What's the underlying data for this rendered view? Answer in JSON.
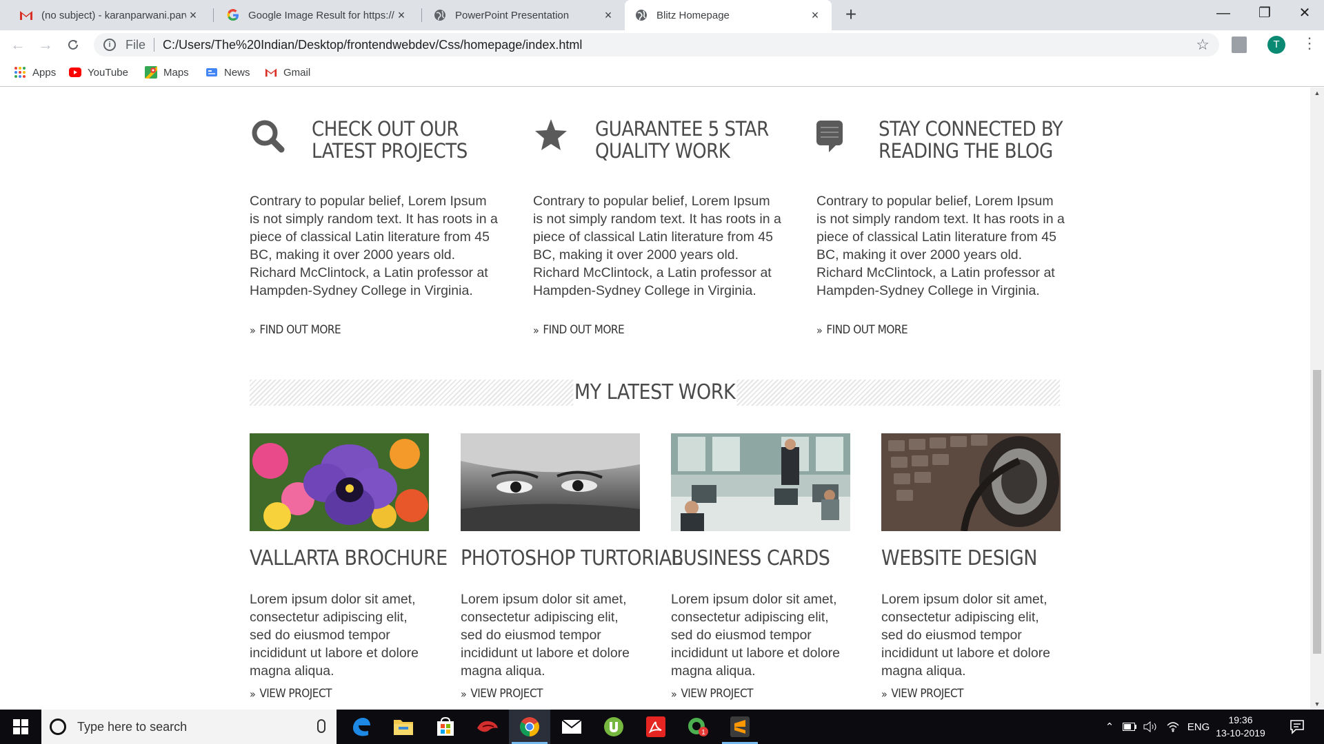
{
  "browser": {
    "tabs": [
      {
        "title": "(no subject) - karanparwani.parw",
        "favicon": "gmail-icon",
        "active": false
      },
      {
        "title": "Google Image Result for https://",
        "favicon": "google-icon",
        "active": false
      },
      {
        "title": "PowerPoint Presentation",
        "favicon": "globe-icon",
        "active": false
      },
      {
        "title": "Blitz Homepage",
        "favicon": "globe-icon",
        "active": true
      }
    ],
    "tab_close": "×",
    "new_tab": "+",
    "window_controls": {
      "minimize": "—",
      "maximize": "❐",
      "close": "✕"
    },
    "address": {
      "scheme_label": "File",
      "url": "C:/Users/The%20Indian/Desktop/frontendwebdev/Css/homepage/index.html"
    },
    "profile_initial": "T",
    "bookmarks": [
      "Apps",
      "YouTube",
      "Maps",
      "News",
      "Gmail"
    ]
  },
  "page": {
    "features": [
      {
        "icon": "search-icon",
        "title": "Check out our latest projects",
        "text": "Contrary to popular belief, Lorem Ipsum is not simply random text. It has roots in a piece of classical Latin literature from 45 BC, making it over 2000 years old. Richard McClintock, a Latin professor at Hampden-Sydney College in Virginia.",
        "link": "FIND OUT MORE"
      },
      {
        "icon": "star-icon",
        "title": "Guarantee 5 star quality work",
        "text": "Contrary to popular belief, Lorem Ipsum is not simply random text. It has roots in a piece of classical Latin literature from 45 BC, making it over 2000 years old. Richard McClintock, a Latin professor at Hampden-Sydney College in Virginia.",
        "link": "FIND OUT MORE"
      },
      {
        "icon": "chat-bubble-icon",
        "title": "Stay connected by reading the blog",
        "text": "Contrary to popular belief, Lorem Ipsum is not simply random text. It has roots in a piece of classical Latin literature from 45 BC, making it over 2000 years old. Richard McClintock, a Latin professor at Hampden-Sydney College in Virginia.",
        "link": "FIND OUT MORE"
      }
    ],
    "section_title": "MY LATEST WORK",
    "projects": [
      {
        "title": "VALLARTA BROCHURE",
        "text": "Lorem ipsum dolor sit amet, consectetur adipiscing elit, sed do eiusmod tempor incididunt ut labore et dolore magna aliqua.",
        "link": "VIEW PROJECT",
        "image": "flower-photo"
      },
      {
        "title": "PHOTOSHOP TURTORIAL",
        "text": "Lorem ipsum dolor sit amet, consectetur adipiscing elit, sed do eiusmod tempor incididunt ut labore et dolore magna aliqua.",
        "link": "VIEW PROJECT",
        "image": "eyes-photo"
      },
      {
        "title": "BUSINESS CARDS",
        "text": "Lorem ipsum dolor sit amet, consectetur adipiscing elit, sed do eiusmod tempor incididunt ut labore et dolore magna aliqua.",
        "link": "VIEW PROJECT",
        "image": "office-photo"
      },
      {
        "title": "WEBSITE DESIGN",
        "text": "Lorem ipsum dolor sit amet, consectetur adipiscing elit, sed do eiusmod tempor incididunt ut labore et dolore magna aliqua.",
        "link": "VIEW PROJECT",
        "image": "headphones-keyboard-photo"
      }
    ]
  },
  "taskbar": {
    "search_placeholder": "Type here to search",
    "apps": [
      "edge-icon",
      "file-explorer-icon",
      "store-icon",
      "app-red-icon",
      "chrome-icon",
      "mail-icon",
      "utorrent-icon",
      "acrobat-icon",
      "messenger-icon",
      "sublime-text-icon"
    ],
    "tray": {
      "language": "ENG",
      "time": "19:36",
      "date": "13-10-2019",
      "notification_count": "1"
    }
  },
  "colors": {
    "tabbar": "#dee1e6",
    "heading": "#4a4a4a",
    "body_text": "#3f3f3f",
    "taskbar": "#0b0b10",
    "avatar": "#0b8a73"
  }
}
